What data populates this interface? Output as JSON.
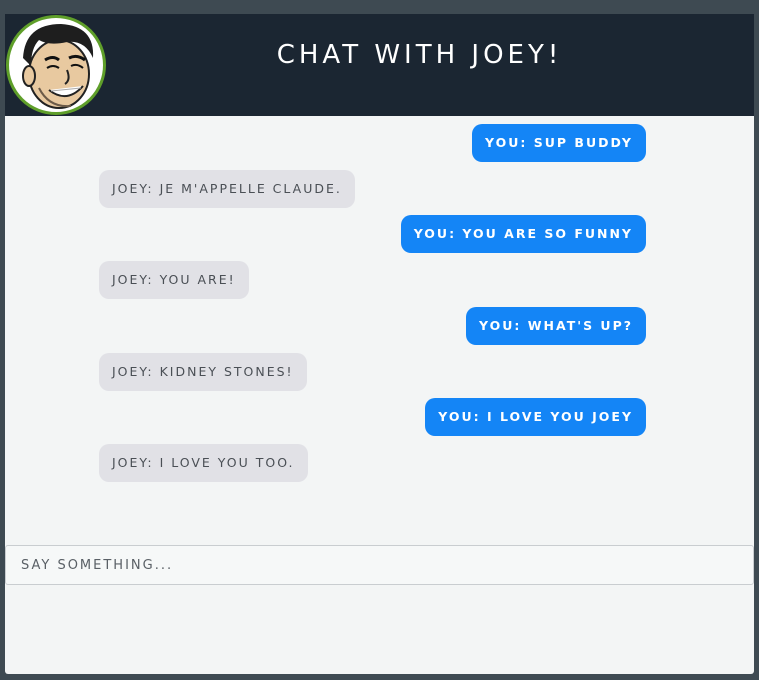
{
  "header": {
    "title": "CHAT WITH JOEY!",
    "avatar_icon": "joey-avatar-icon"
  },
  "messages": [
    {
      "sender": "you",
      "text": "YOU: SUP BUDDY"
    },
    {
      "sender": "joey",
      "text": "JOEY: JE M'APPELLE CLAUDE."
    },
    {
      "sender": "you",
      "text": "YOU: YOU ARE SO FUNNY"
    },
    {
      "sender": "joey",
      "text": "JOEY: YOU ARE!"
    },
    {
      "sender": "you",
      "text": "YOU: WHAT'S UP?"
    },
    {
      "sender": "joey",
      "text": "JOEY: KIDNEY STONES!"
    },
    {
      "sender": "you",
      "text": "YOU: I LOVE YOU JOEY"
    },
    {
      "sender": "joey",
      "text": "JOEY: I LOVE YOU TOO."
    }
  ],
  "input": {
    "placeholder": "SAY SOMETHING...",
    "value": ""
  },
  "colors": {
    "header_bg": "#1b2632",
    "you_bubble": "#1485f6",
    "joey_bubble": "#e1e1e6",
    "avatar_border": "#5f9f2a",
    "page_bg": "#3e4a52",
    "panel_bg": "#f3f5f5"
  }
}
